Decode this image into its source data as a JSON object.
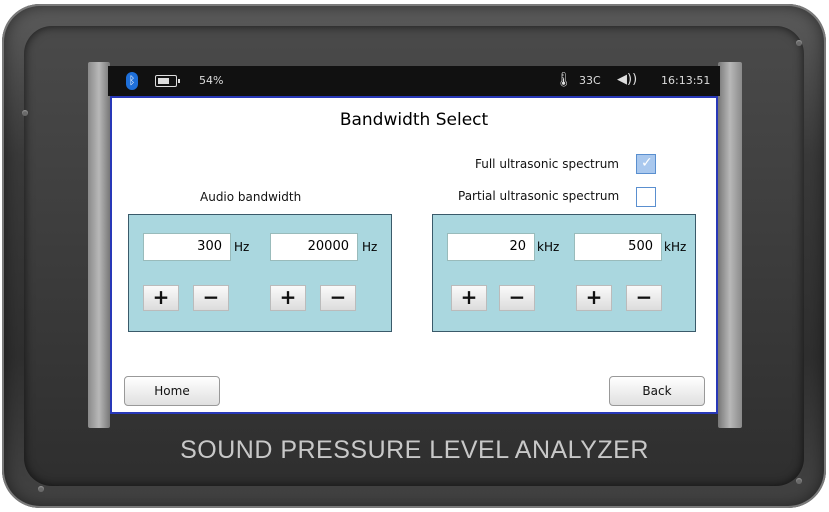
{
  "status": {
    "battery": "54%",
    "temperature": "33C",
    "time": "16:13:51"
  },
  "screen": {
    "title": "Bandwidth Select",
    "full_label": "Full ultrasonic spectrum",
    "full_checked": true,
    "partial_label": "Partial ultrasonic spectrum",
    "partial_checked": false,
    "audio_label": "Audio bandwidth"
  },
  "audio_panel": {
    "low_value": "300",
    "low_unit": "Hz",
    "high_value": "20000",
    "high_unit": "Hz"
  },
  "ultra_panel": {
    "low_value": "20",
    "low_unit": "kHz",
    "high_value": "500",
    "high_unit": "kHz"
  },
  "buttons": {
    "plus": "+",
    "minus": "−",
    "home": "Home",
    "back": "Back"
  },
  "device": {
    "brand": "SOUND PRESSURE LEVEL ANALYZER"
  }
}
